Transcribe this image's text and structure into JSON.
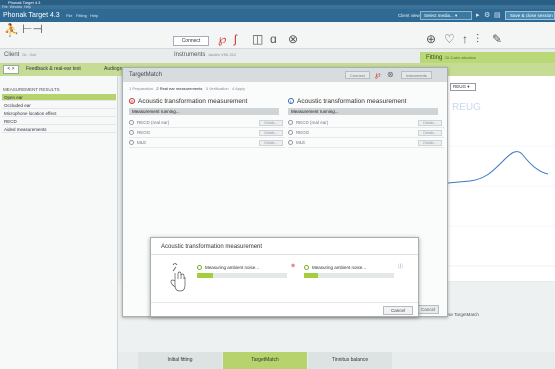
{
  "window": {
    "title": "Phonak Target 4.3",
    "menu": [
      "File",
      "Window",
      "Help"
    ]
  },
  "appbar": {
    "app_name": "Phonak Target 4.3",
    "menu": [
      "File",
      "Fitting",
      "Help"
    ],
    "client_view": "Client view",
    "select_media": "Select media...",
    "save_close": "Save & close session"
  },
  "toolbar": {
    "connect": "Connect"
  },
  "client": {
    "label": "Client",
    "name": "Dr., Gol"
  },
  "instruments": {
    "label": "Instruments",
    "model": "Audéo V90-312"
  },
  "fitting": {
    "label": "Fitting",
    "sub": "ID-Calm situation"
  },
  "nav": {
    "arrows": "< >",
    "tab1": "Feedback & real-ear test",
    "tab2": "Audiogram"
  },
  "sidebar": {
    "header": "MEASUREMENT RESULTS",
    "items": [
      {
        "label": "Open ear",
        "active": true
      },
      {
        "label": "Occluded ear",
        "active": false
      },
      {
        "label": "Microphone location effect",
        "active": false
      },
      {
        "label": "RECD",
        "active": false
      },
      {
        "label": "Aided measurements",
        "active": false
      }
    ]
  },
  "graph": {
    "select_label": "REUG",
    "ghost_label": "REUG"
  },
  "targetmatch": {
    "title": "TargetMatch",
    "title_buttons": [
      "Connect",
      "Instruments"
    ],
    "steps": {
      "s1": "1 Preparation",
      "s2": "2 Real ear measurements",
      "s3": "3 Verification",
      "s4": "4 Apply"
    },
    "left": {
      "heading": "Acoustic transformation measurement",
      "status": "Measurement running...",
      "options": [
        "RECD (real ear)",
        "REOG",
        "MLE"
      ],
      "details": "Details..."
    },
    "right": {
      "heading": "Acoustic transformation measurement",
      "status": "Measurement running...",
      "options": [
        "RECD (real ear)",
        "REOG",
        "MLE"
      ],
      "details": "Details..."
    },
    "cancel": "Cancel"
  },
  "progress_dialog": {
    "title": "Acoustic transformation measurement",
    "left_label": "Measuring ambient noise...",
    "right_label": "Measuring ambient noise...",
    "left_progress": 0.18,
    "right_progress": 0.15,
    "cancel": "Cancel"
  },
  "behind": {
    "use_targetmatch": "Use TargetMatch"
  },
  "bottom_tabs": [
    {
      "label": "Initial fitting",
      "active": false
    },
    {
      "label": "TargetMatch",
      "active": true
    },
    {
      "label": "Tinnitus balance",
      "active": false
    }
  ],
  "colors": {
    "accent_green": "#b6d36e",
    "header_blue": "#2e6a94",
    "curve_blue": "#3a78c2",
    "right_ear": "#d03232",
    "left_ear": "#3a6fb0"
  }
}
